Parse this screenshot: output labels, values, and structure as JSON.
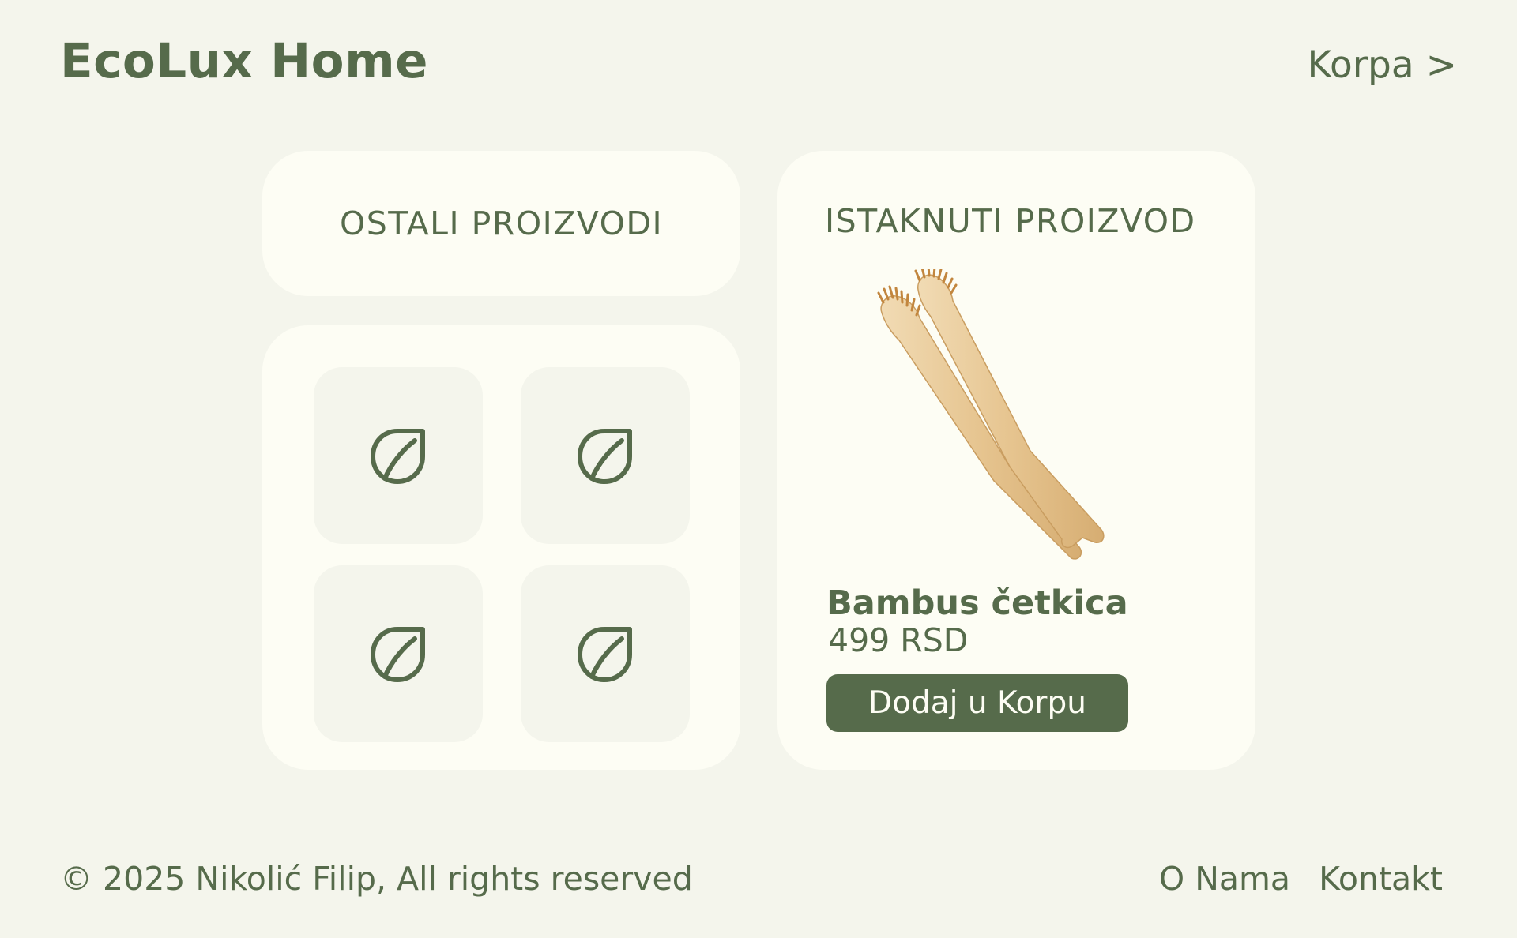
{
  "header": {
    "brand": "EcoLux Home",
    "cart_link": "Korpa >"
  },
  "other_products": {
    "title": "OSTALI PROIZVODI",
    "tiles": [
      {
        "icon": "leaf-icon"
      },
      {
        "icon": "leaf-icon"
      },
      {
        "icon": "leaf-icon"
      },
      {
        "icon": "leaf-icon"
      }
    ]
  },
  "featured": {
    "title": "ISTAKNUTI PROIZVOD",
    "image": "bamboo-toothbrush-image",
    "name": "Bambus četkica",
    "price": "499 RSD",
    "button_label": "Dodaj u Korpu"
  },
  "footer": {
    "copyright": "© 2025 Nikolić Filip, All rights reserved",
    "links": [
      "O Nama",
      "Kontakt"
    ]
  },
  "colors": {
    "background": "#f4f5ec",
    "card": "#fdfdf4",
    "accent": "#566b4b",
    "bamboo": "#e8c99a"
  }
}
